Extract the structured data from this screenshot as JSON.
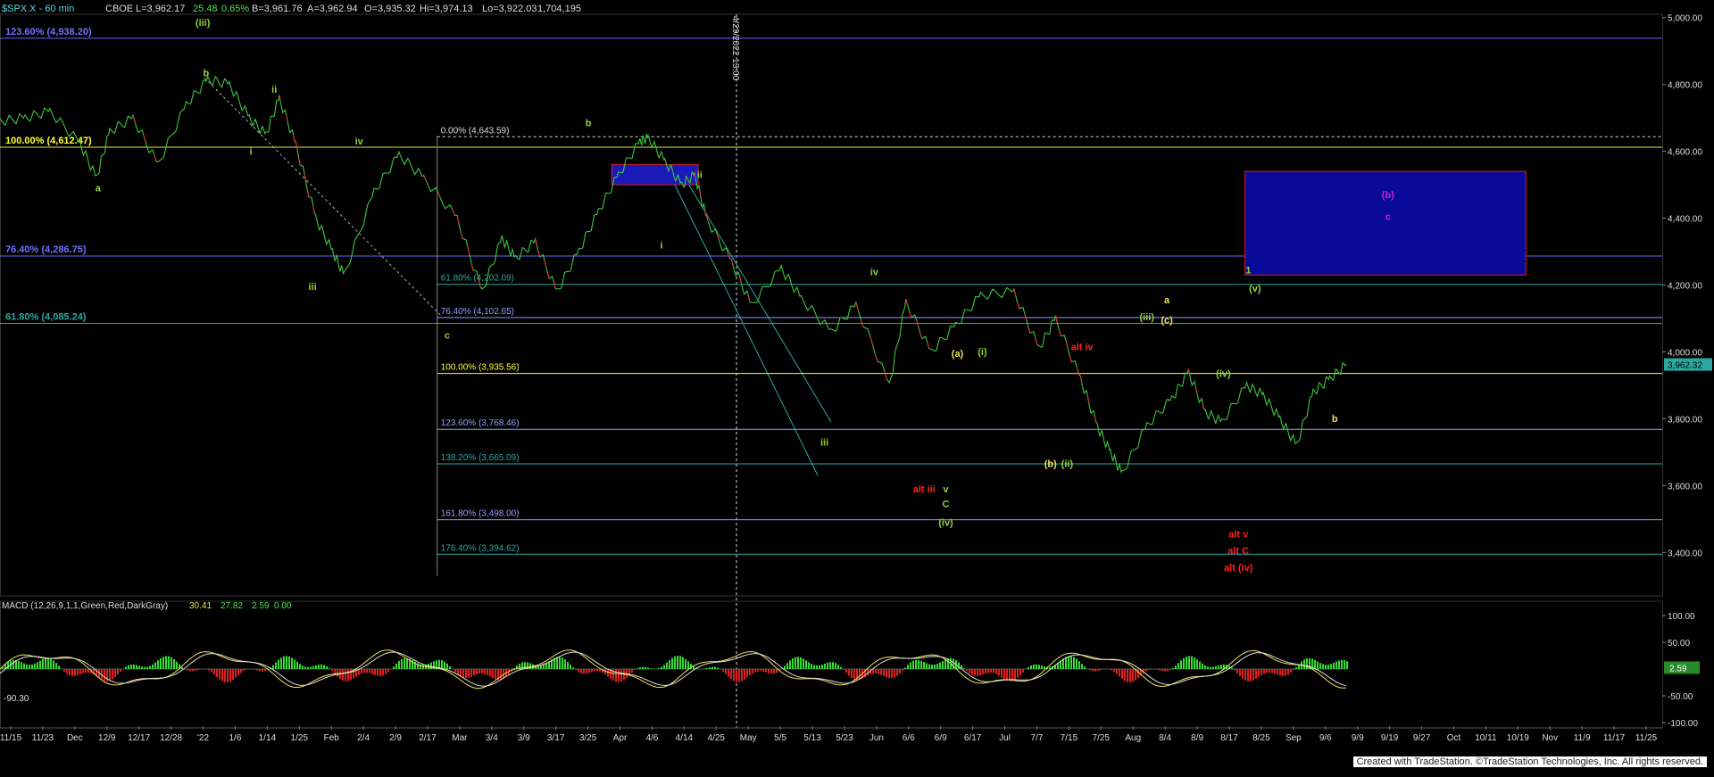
{
  "chart_data": {
    "type": "line",
    "header": {
      "symbol": "$SPX.X - 60 min",
      "exchange": "CBOE",
      "last": "L=3,962.17",
      "change": "25.48",
      "change_pct": "0.65%",
      "bid": "B=3,961.76",
      "ask": "A=3,962.94",
      "open": "O=3,935.32",
      "high": "Hi=3,974.13",
      "low": "Lo=3,922.03",
      "volume": "1,704,195"
    },
    "y_ticks": [
      {
        "v": 5000,
        "label": "5,000.00"
      },
      {
        "v": 4800,
        "label": "4,800.00"
      },
      {
        "v": 4600,
        "label": "4,600.00"
      },
      {
        "v": 4400,
        "label": "4,400.00"
      },
      {
        "v": 4200,
        "label": "4,200.00"
      },
      {
        "v": 4000,
        "label": "4,000.00"
      },
      {
        "v": 3800,
        "label": "3,800.00"
      },
      {
        "v": 3600,
        "label": "3,600.00"
      },
      {
        "v": 3400,
        "label": "3,400.00"
      }
    ],
    "ylim": [
      3270,
      5010
    ],
    "last_price_label": "3,962.32",
    "x_ticks": [
      "11/15",
      "11/23",
      "Dec",
      "12/9",
      "12/17",
      "12/28",
      "'22",
      "1/6",
      "1/14",
      "1/25",
      "Feb",
      "2/4",
      "2/9",
      "2/17",
      "Mar",
      "3/4",
      "3/9",
      "3/17",
      "3/25",
      "Apr",
      "4/6",
      "4/14",
      "4/25",
      "May",
      "5/5",
      "5/13",
      "5/23",
      "Jun",
      "6/6",
      "6/9",
      "6/17",
      "Jul",
      "7/7",
      "7/15",
      "7/25",
      "Aug",
      "8/4",
      "8/9",
      "8/17",
      "8/25",
      "Sep",
      "9/6",
      "9/9",
      "9/19",
      "9/27",
      "Oct",
      "10/11",
      "10/19",
      "Nov",
      "11/9",
      "11/17",
      "11/25"
    ],
    "price_series": [
      [
        0,
        4690
      ],
      [
        0.015,
        4700
      ],
      [
        0.03,
        4720
      ],
      [
        0.048,
        4625
      ],
      [
        0.058,
        4520
      ],
      [
        0.066,
        4660
      ],
      [
        0.08,
        4700
      ],
      [
        0.095,
        4560
      ],
      [
        0.112,
        4740
      ],
      [
        0.125,
        4815
      ],
      [
        0.138,
        4800
      ],
      [
        0.15,
        4700
      ],
      [
        0.16,
        4650
      ],
      [
        0.168,
        4760
      ],
      [
        0.178,
        4620
      ],
      [
        0.19,
        4400
      ],
      [
        0.2,
        4300
      ],
      [
        0.207,
        4230
      ],
      [
        0.225,
        4480
      ],
      [
        0.24,
        4590
      ],
      [
        0.255,
        4520
      ],
      [
        0.275,
        4400
      ],
      [
        0.29,
        4180
      ],
      [
        0.302,
        4340
      ],
      [
        0.31,
        4280
      ],
      [
        0.322,
        4330
      ],
      [
        0.335,
        4180
      ],
      [
        0.348,
        4300
      ],
      [
        0.36,
        4420
      ],
      [
        0.372,
        4530
      ],
      [
        0.385,
        4630
      ],
      [
        0.39,
        4640
      ],
      [
        0.4,
        4570
      ],
      [
        0.41,
        4500
      ],
      [
        0.418,
        4530
      ],
      [
        0.425,
        4400
      ],
      [
        0.44,
        4270
      ],
      [
        0.452,
        4140
      ],
      [
        0.47,
        4250
      ],
      [
        0.482,
        4160
      ],
      [
        0.5,
        4060
      ],
      [
        0.515,
        4140
      ],
      [
        0.535,
        3900
      ],
      [
        0.545,
        4150
      ],
      [
        0.56,
        4000
      ],
      [
        0.575,
        4080
      ],
      [
        0.59,
        4170
      ],
      [
        0.61,
        4180
      ],
      [
        0.625,
        4010
      ],
      [
        0.635,
        4100
      ],
      [
        0.65,
        3920
      ],
      [
        0.66,
        3780
      ],
      [
        0.668,
        3700
      ],
      [
        0.675,
        3636
      ],
      [
        0.69,
        3780
      ],
      [
        0.705,
        3860
      ],
      [
        0.715,
        3940
      ],
      [
        0.725,
        3820
      ],
      [
        0.735,
        3790
      ],
      [
        0.75,
        3900
      ],
      [
        0.76,
        3870
      ],
      [
        0.77,
        3800
      ],
      [
        0.78,
        3720
      ],
      [
        0.79,
        3880
      ],
      [
        0.8,
        3920
      ],
      [
        0.81,
        3962
      ]
    ],
    "wave_labels": [
      {
        "t": "(iii)",
        "x": 0.122,
        "y": 4975,
        "c": "#8fd43a"
      },
      {
        "t": "b",
        "x": 0.124,
        "y": 4825,
        "c": "#8fd43a"
      },
      {
        "t": "a",
        "x": 0.059,
        "y": 4480,
        "c": "#8fd43a"
      },
      {
        "t": "ii",
        "x": 0.165,
        "y": 4775,
        "c": "#8fd43a"
      },
      {
        "t": "i",
        "x": 0.151,
        "y": 4590,
        "c": "#8fd43a"
      },
      {
        "t": "iv",
        "x": 0.216,
        "y": 4620,
        "c": "#8fd43a"
      },
      {
        "t": "iii",
        "x": 0.188,
        "y": 4185,
        "c": "#8fd43a"
      },
      {
        "t": "c",
        "x": 0.269,
        "y": 4040,
        "c": "#8fd43a"
      },
      {
        "t": "b",
        "x": 0.354,
        "y": 4675,
        "c": "#8fd43a"
      },
      {
        "t": "ii",
        "x": 0.421,
        "y": 4520,
        "c": "#8fd43a"
      },
      {
        "t": "i",
        "x": 0.398,
        "y": 4310,
        "c": "#8fd43a"
      },
      {
        "t": "iii",
        "x": 0.496,
        "y": 3720,
        "c": "#8fd43a"
      },
      {
        "t": "iv",
        "x": 0.526,
        "y": 4230,
        "c": "#8fd43a"
      },
      {
        "t": "alt iii",
        "x": 0.556,
        "y": 3580,
        "c": "#ff2020"
      },
      {
        "t": "v",
        "x": 0.569,
        "y": 3580,
        "c": "#8fd43a"
      },
      {
        "t": "C",
        "x": 0.569,
        "y": 3535,
        "c": "#8fd43a"
      },
      {
        "t": "(iv)",
        "x": 0.569,
        "y": 3480,
        "c": "#8fd43a"
      },
      {
        "t": "(a)",
        "x": 0.576,
        "y": 3985,
        "c": "#f0e05a"
      },
      {
        "t": "(i)",
        "x": 0.591,
        "y": 3990,
        "c": "#8fd43a"
      },
      {
        "t": "(b)",
        "x": 0.632,
        "y": 3655,
        "c": "#f0e05a"
      },
      {
        "t": "(ii)",
        "x": 0.642,
        "y": 3655,
        "c": "#8fd43a"
      },
      {
        "t": "alt iv",
        "x": 0.651,
        "y": 4005,
        "c": "#ff2020"
      },
      {
        "t": "(iii)",
        "x": 0.69,
        "y": 4095,
        "c": "#8fd43a"
      },
      {
        "t": "a",
        "x": 0.702,
        "y": 4145,
        "c": "#f0e05a"
      },
      {
        "t": "(c)",
        "x": 0.702,
        "y": 4085,
        "c": "#f0e05a"
      },
      {
        "t": "1",
        "x": 0.751,
        "y": 4235,
        "c": "#8fd43a"
      },
      {
        "t": "(v)",
        "x": 0.755,
        "y": 4180,
        "c": "#8fd43a"
      },
      {
        "t": "(iv)",
        "x": 0.736,
        "y": 3925,
        "c": "#8fd43a"
      },
      {
        "t": "b",
        "x": 0.803,
        "y": 3790,
        "c": "#f0e05a"
      },
      {
        "t": "(b)",
        "x": 0.835,
        "y": 4460,
        "c": "#d020d0"
      },
      {
        "t": "c",
        "x": 0.835,
        "y": 4395,
        "c": "#d020d0"
      },
      {
        "t": "alt v",
        "x": 0.745,
        "y": 3445,
        "c": "#ff2020"
      },
      {
        "t": "alt C",
        "x": 0.745,
        "y": 3395,
        "c": "#ff2020"
      },
      {
        "t": "alt (iv)",
        "x": 0.745,
        "y": 3345,
        "c": "#ff2020"
      }
    ],
    "long_fibs": [
      {
        "label": "123.60% (4,938.20)",
        "v": 4938.2,
        "c": "#7070ff",
        "lc": "#6666ff"
      },
      {
        "label": "100.00% (4,612.47)",
        "v": 4612.47,
        "c": "#ffff30",
        "lc": "#e6e640"
      },
      {
        "label": "76.40% (4,286.75)",
        "v": 4286.75,
        "c": "#7070ff",
        "lc": "#6666ff"
      },
      {
        "label": "61.80% (4,085.24)",
        "v": 4085.24,
        "c": "#2aa8a0",
        "lc": "#2aa8a0"
      }
    ],
    "short_fibs": [
      {
        "label": "0.00% (4,643.59)",
        "v": 4643.59,
        "c": "#dddddd",
        "dashed": true
      },
      {
        "label": "61.80% (4,202.09)",
        "v": 4202.09,
        "c": "#2aa8a0"
      },
      {
        "label": "76.40% (4,102.65)",
        "v": 4102.65,
        "c": "#9999ff"
      },
      {
        "label": "100.00% (3,935.56)",
        "v": 3935.56,
        "c": "#ffff30"
      },
      {
        "label": "123.60% (3,768.46)",
        "v": 3768.46,
        "c": "#9999ff"
      },
      {
        "label": "138.20% (3,665.09)",
        "v": 3665.09,
        "c": "#2aa8a0"
      },
      {
        "label": "161.80% (3,498.00)",
        "v": 3498.0,
        "c": "#9999ff"
      },
      {
        "label": "176.40% (3,394.62)",
        "v": 3394.62,
        "c": "#2aa8a0"
      }
    ],
    "target_box": {
      "x1": 0.749,
      "x2": 0.918,
      "y1": 4230,
      "y2": 4540
    },
    "box_small": {
      "x1": 0.368,
      "x2": 0.42,
      "y1": 4500,
      "y2": 4560
    },
    "vline_label": "4/29/2022 13:00",
    "macd": {
      "title": "MACD (12,26,9,1,1,Green,Red,DarkGray)",
      "v1": "30.41",
      "v2": "27.82",
      "v3": "2.59",
      "v4": "0.00",
      "y_ticks": [
        "100.00",
        "50.00",
        "-50.00",
        "-100.00"
      ],
      "min_label": "-90.30",
      "last_label": "2.59"
    }
  },
  "footer": {
    "credit": "Created with TradeStation. ©TradeStation Technologies, Inc. All rights reserved."
  }
}
